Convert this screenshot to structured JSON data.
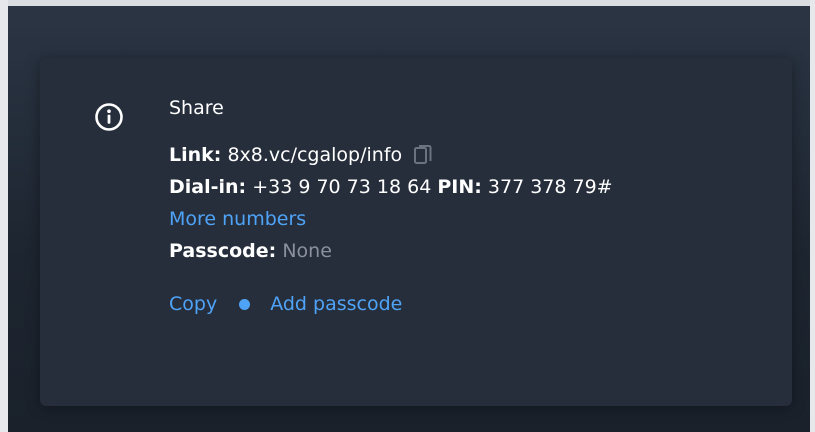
{
  "share": {
    "title": "Share",
    "link_label": "Link:",
    "link_value": "8x8.vc/cgalop/info",
    "dial_label": "Dial-in:",
    "dial_value": "+33 9 70 73 18 64",
    "pin_label": "PIN:",
    "pin_value": "377 378 79#",
    "more_numbers": "More numbers",
    "passcode_label": "Passcode:",
    "passcode_value": "None",
    "copy_label": "Copy",
    "add_passcode_label": "Add passcode"
  },
  "icons": {
    "info": "info-icon",
    "copy": "copy-icon"
  },
  "colors": {
    "accent": "#4fa3f7",
    "card": "#262e3c",
    "muted": "#8a919c"
  }
}
